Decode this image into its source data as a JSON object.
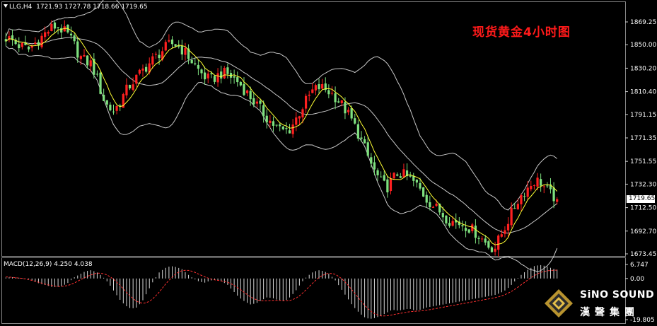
{
  "header": {
    "symbol": "LLG,H4",
    "ohlc": "1721.93 1727.78 1718.66 1719.65"
  },
  "title": "现货黄金4小时图",
  "macd": {
    "label": "MACD(12,26,9) 4.250 4.038",
    "yticks": [
      "6.747",
      "0.00",
      "-19.805"
    ]
  },
  "current_price": "1719.65",
  "logo": {
    "brand": "SiNO SOUND",
    "brand_cn": "漢聲集團"
  },
  "colors": {
    "background": "#000000",
    "up_candle": "#ff2020",
    "down_candle": "#7ee07e",
    "bands": "#c8c8c8",
    "ma": "#ffff33",
    "macd_signal": "#ff3030",
    "title": "#ff1a1a"
  },
  "chart_data": {
    "type": "candlestick",
    "instrument": "LLG,H4",
    "y_axis": {
      "ticks": [
        1869.25,
        1850.0,
        1830.2,
        1810.4,
        1791.15,
        1771.35,
        1751.55,
        1732.3,
        1712.5,
        1692.7,
        1673.45
      ],
      "tick_labels": [
        "1869.25",
        "1850.00",
        "1830.20",
        "1810.40",
        "1791.15",
        "1771.35",
        "1751.55",
        "1732.30",
        "1712.50",
        "1692.70",
        "1673.45"
      ],
      "range": [
        1670,
        1880
      ]
    },
    "indicators": [
      "Bollinger Bands",
      "Moving Average",
      "MACD(12,26,9)"
    ],
    "close_path": [
      1856,
      1854,
      1850,
      1848,
      1846,
      1851,
      1855,
      1860,
      1864,
      1866,
      1862,
      1858,
      1850,
      1840,
      1836,
      1834,
      1822,
      1806,
      1797,
      1794,
      1801,
      1810,
      1817,
      1822,
      1828,
      1833,
      1838,
      1843,
      1847,
      1851,
      1850,
      1846,
      1841,
      1834,
      1828,
      1823,
      1820,
      1823,
      1826,
      1825,
      1822,
      1818,
      1812,
      1806,
      1800,
      1794,
      1788,
      1783,
      1779,
      1777,
      1779,
      1787,
      1796,
      1804,
      1811,
      1814,
      1813,
      1810,
      1806,
      1800,
      1793,
      1785,
      1775,
      1764,
      1752,
      1742,
      1734,
      1729,
      1736,
      1742,
      1740,
      1737,
      1733,
      1727,
      1720,
      1715,
      1711,
      1706,
      1702,
      1700,
      1699,
      1697,
      1694,
      1690,
      1685,
      1680,
      1678,
      1688,
      1698,
      1708,
      1718,
      1725,
      1730,
      1735,
      1735,
      1728,
      1723,
      1719.65
    ],
    "macd": {
      "range": [
        -19.805,
        6.747
      ],
      "histogram_path": [
        0.5,
        0.6,
        0.4,
        0.2,
        -0.5,
        -1.5,
        -2.5,
        -3.2,
        -4.0,
        -4.2,
        -3.5,
        -2.0,
        0.5,
        2.0,
        3.5,
        4.0,
        3.0,
        1.0,
        -2.0,
        -6.0,
        -10.0,
        -13.0,
        -14.5,
        -14.0,
        -11.0,
        -6.0,
        -1.0,
        3.0,
        5.0,
        6.0,
        5.5,
        4.5,
        2.0,
        0.0,
        -1.5,
        -2.0,
        -1.0,
        -0.5,
        -1.5,
        -3.0,
        -6.0,
        -9.0,
        -11.0,
        -12.5,
        -12.0,
        -10.5,
        -9.0,
        -9.5,
        -10.5,
        -11.0,
        -9.0,
        -6.0,
        -2.0,
        1.0,
        3.0,
        4.0,
        3.5,
        2.0,
        -1.0,
        -5.0,
        -9.0,
        -13.0,
        -16.0,
        -18.5,
        -19.5,
        -19.0,
        -18.0,
        -16.5,
        -15.0,
        -15.5,
        -15.0,
        -14.5,
        -15.5,
        -15.0,
        -14.0,
        -13.5,
        -13.0,
        -12.5,
        -12.0,
        -11.5,
        -11.0,
        -10.5,
        -10.0,
        -9.5,
        -9.0,
        -8.5,
        -8.0,
        -7.0,
        -5.5,
        -3.0,
        0.0,
        2.5,
        4.5,
        6.0,
        6.5,
        6.0,
        5.0,
        4.25
      ],
      "signal_path": [
        0.8,
        0.6,
        0.3,
        0.0,
        -0.5,
        -1.2,
        -2.0,
        -2.8,
        -3.4,
        -3.8,
        -3.8,
        -3.3,
        -2.2,
        -0.8,
        0.6,
        1.8,
        2.6,
        2.5,
        1.5,
        -0.5,
        -3.0,
        -6.0,
        -8.8,
        -11.0,
        -12.0,
        -11.5,
        -9.5,
        -6.5,
        -3.0,
        0.0,
        2.5,
        3.8,
        4.0,
        3.3,
        2.0,
        0.8,
        -0.2,
        -0.8,
        -1.2,
        -1.8,
        -3.0,
        -4.8,
        -6.8,
        -8.8,
        -10.2,
        -10.8,
        -10.8,
        -10.5,
        -10.5,
        -10.7,
        -10.6,
        -9.6,
        -7.6,
        -5.0,
        -2.2,
        0.3,
        2.0,
        2.6,
        2.0,
        0.2,
        -2.5,
        -5.8,
        -9.2,
        -12.5,
        -15.3,
        -17.2,
        -18.0,
        -18.0,
        -17.5,
        -17.0,
        -16.5,
        -16.0,
        -15.8,
        -15.6,
        -15.3,
        -14.8,
        -14.3,
        -13.8,
        -13.3,
        -12.8,
        -12.3,
        -11.8,
        -11.3,
        -10.8,
        -10.3,
        -9.8,
        -9.3,
        -8.6,
        -7.6,
        -6.2,
        -4.4,
        -2.4,
        -0.4,
        1.4,
        2.9,
        3.6,
        3.9,
        4.038
      ]
    }
  }
}
